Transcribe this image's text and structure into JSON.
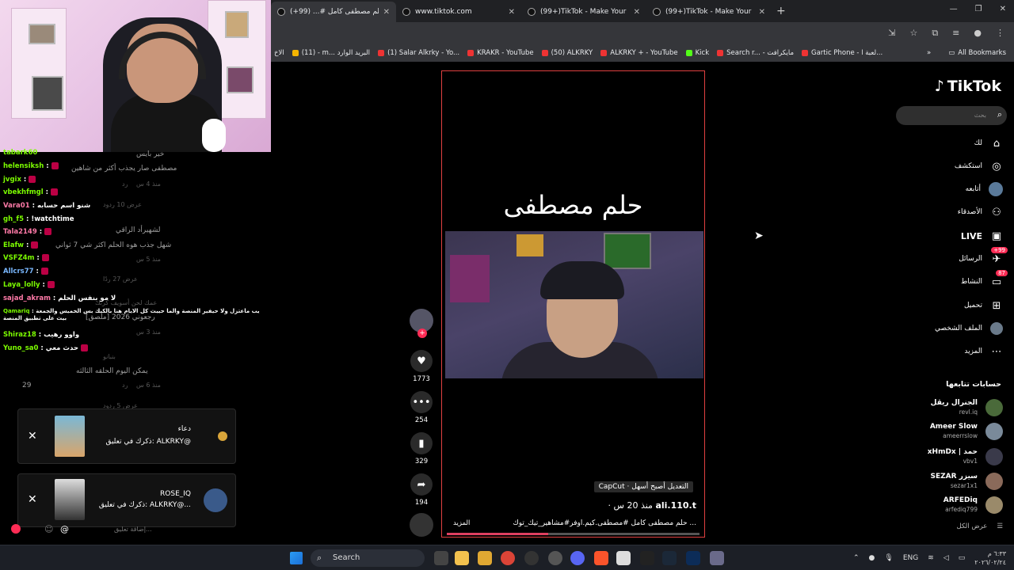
{
  "browser": {
    "tabs": [
      {
        "title": "حلم مصطفى كامل #... (99+)",
        "active": true
      },
      {
        "title": "www.tiktok.com",
        "active": false
      },
      {
        "title": "(99+)TikTok - Make Your Day",
        "active": false
      },
      {
        "title": "(99+)TikTok - Make Your Day",
        "active": false
      }
    ],
    "bookmarks": [
      "الاخ",
      "(11) - m... البريد الوارد",
      "(1) Salar Alkrky - Yo...",
      "KRAKR - YouTube",
      "(50) ALKRKY",
      "ALKRKY + - YouTube",
      "Kick",
      "Search r... - مايكرافت",
      "Gartic Phone - لعبة ا..."
    ],
    "all_bookmarks": "All Bookmarks"
  },
  "chat": {
    "lines": [
      {
        "user": "tabark60",
        "text": ""
      },
      {
        "user": "helensiksh",
        "text": ""
      },
      {
        "user": "jvgix",
        "text": ""
      },
      {
        "user": "vbekhfmgl",
        "text": ""
      },
      {
        "user": "Vara01",
        "text": "شنو اسم حسابه"
      },
      {
        "user": "gh_f5",
        "text": "!watchtime"
      },
      {
        "user": "Tala2149",
        "text": ""
      },
      {
        "user": "Elafw",
        "text": ""
      },
      {
        "user": "VSFZ4m",
        "text": ""
      },
      {
        "user": "Allcrs77",
        "text": ""
      },
      {
        "user": "Laya_lolly",
        "text": ""
      },
      {
        "user": "sajad_akram",
        "text": "لا مو بنفس الحلم"
      },
      {
        "user": "Qamariq",
        "text": "يب ماعتزل ولا حيفير المنصة والما حييث كل الايام هنا بالكيك بس الخميس والجمعة بيث على تطبيق المنصة"
      },
      {
        "user": "Shiraz18",
        "text": "واوو رهيب"
      },
      {
        "user": "Yuno_sa0",
        "text": "حدث معي"
      }
    ]
  },
  "tiktok_comments": {
    "c1_user": "خير بايس",
    "c1_text": "مصطفى صار يجذب أكثر من شاهين",
    "c1_meta": "منذ 4 س",
    "reply": "رد",
    "view_replies_1": "عرض 10 ردود",
    "c2_user": "لشهيرأد الراقي",
    "c2_text": "شهل جذب هوه الحلم اكثر شي 7 ثواني",
    "c2_meta": "منذ 5 س",
    "view_replies_2": "عرض 27 ردًا",
    "c3_text": "عمك لحن أسويف كرنك",
    "c3_sub": "[ملصق] رجعوني 2026",
    "c3_meta": "منذ 3 س",
    "c4_user": "بنبانو",
    "c4_text": "يمكن اليوم الحلقه الثالثه",
    "c4_meta": "منذ 6 س",
    "likes": "29",
    "view_replies_3": "عرض 5 ردود"
  },
  "notifications": [
    {
      "line1": "دعاء",
      "line2": "ذكرك في تعليق: ALKRKY@"
    },
    {
      "line1": "ROSE_IQ",
      "line2": "ذكرك في تعليق: ALKRKY@..."
    }
  ],
  "comment_input": {
    "placeholder": "إضافة تعليق..."
  },
  "video": {
    "title": "حلم مصطفى",
    "capcut": "CapCut · التعديل أصبح أسهل",
    "author": "ali.110.t",
    "time": "· منذ 20 س",
    "desc": "حلم مصطفى كامل #مصطفى.كيم.اوفر#مشاهير_تيك_توك ...",
    "more": "المزيد",
    "progress": 0.4
  },
  "actions": {
    "likes": "1773",
    "comments": "254",
    "saves": "329",
    "shares": "194"
  },
  "sidebar": {
    "logo": "TikTok",
    "search_placeholder": "بحث",
    "nav": [
      {
        "label": "لك",
        "icon": "home-icon"
      },
      {
        "label": "استكشف",
        "icon": "compass-icon"
      },
      {
        "label": "أتابعه",
        "icon": "following-icon"
      },
      {
        "label": "الأصدقاء",
        "icon": "friends-icon"
      },
      {
        "label": "LIVE",
        "icon": "live-icon"
      },
      {
        "label": "الرسائل",
        "icon": "message-icon",
        "badge": "+99"
      },
      {
        "label": "النشاط",
        "icon": "activity-icon",
        "badge": "87"
      },
      {
        "label": "تحميل",
        "icon": "upload-icon"
      },
      {
        "label": "الملف الشخصي",
        "icon": "profile-icon"
      },
      {
        "label": "المزيد",
        "icon": "more-icon"
      }
    ],
    "following_heading": "حسابات تتابعها",
    "accounts": [
      {
        "name": "الجنرال ريڤل",
        "handle": "revl.iq"
      },
      {
        "name": "Ameer Slow",
        "handle": "ameerrslow"
      },
      {
        "name": "xHmDx | حمد",
        "handle": "vbv1"
      },
      {
        "name": "SEZAR سيزر",
        "handle": "sezar1x1"
      },
      {
        "name": "ARFEDiq",
        "handle": "arfediq799"
      }
    ],
    "show_all": "عرض الكل"
  },
  "taskbar": {
    "search": "Search",
    "lang": "ENG",
    "time": "٦:٣٣ م",
    "date": "٢٠٢٦/٠٢/٢٤"
  },
  "colors": {
    "tiktok_red": "#fe2c55",
    "chat_green": "#7cfc00",
    "chrome_bg": "#35363a"
  }
}
